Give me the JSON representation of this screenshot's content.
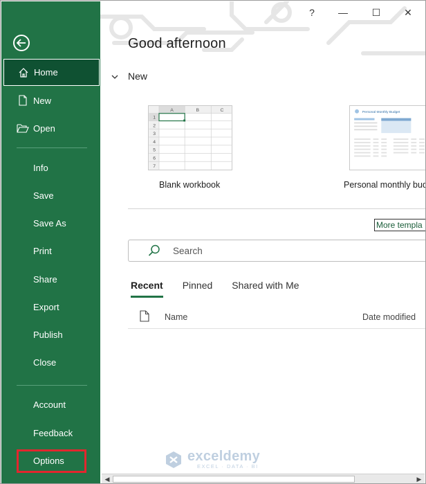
{
  "window": {
    "help_label": "?",
    "minimize_label": "—",
    "maximize_label": "☐",
    "close_label": "✕"
  },
  "sidebar": {
    "back_icon": "back-arrow-icon",
    "items": [
      {
        "label": "Home",
        "icon": "home-icon"
      },
      {
        "label": "New",
        "icon": "new-file-icon"
      },
      {
        "label": "Open",
        "icon": "open-folder-icon"
      },
      {
        "label": "Info"
      },
      {
        "label": "Save"
      },
      {
        "label": "Save As"
      },
      {
        "label": "Print"
      },
      {
        "label": "Share"
      },
      {
        "label": "Export"
      },
      {
        "label": "Publish"
      },
      {
        "label": "Close"
      },
      {
        "label": "Account"
      },
      {
        "label": "Feedback"
      },
      {
        "label": "Options"
      }
    ],
    "accent": "#217346",
    "highlight": "#e3262e"
  },
  "main": {
    "greeting": "Good afternoon",
    "new_section": "New",
    "templates": [
      {
        "label": "Blank workbook",
        "columns": [
          "A",
          "B",
          "C"
        ],
        "rows": [
          "1",
          "2",
          "3",
          "4",
          "5",
          "6",
          "7"
        ]
      },
      {
        "label": "Personal monthly bud",
        "doc_title": "Personal Monthly Budget"
      }
    ],
    "more_templates": "More templa",
    "search_placeholder": "Search",
    "tabs": [
      "Recent",
      "Pinned",
      "Shared with Me"
    ],
    "list_columns": {
      "name": "Name",
      "date": "Date modified"
    }
  },
  "watermark": {
    "brand": "exceldemy",
    "tagline": "EXCEL · DATA · BI"
  },
  "scrollbar": {
    "left": "◀",
    "right": "▶"
  }
}
